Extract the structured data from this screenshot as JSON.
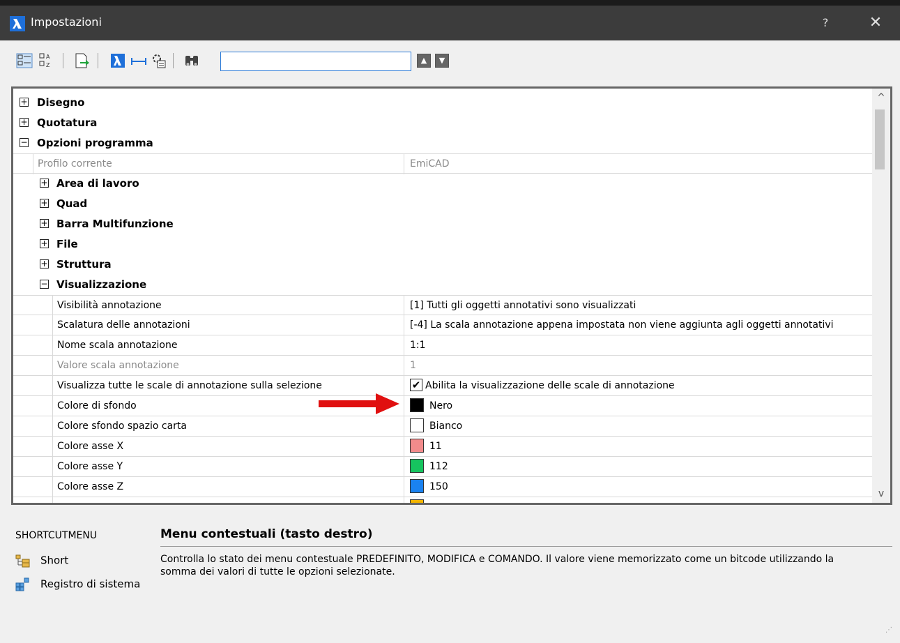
{
  "window": {
    "title": "Impostazioni",
    "help": "?",
    "close": "✕"
  },
  "toolbar": {
    "search_value": "",
    "prev_label": "▲",
    "next_label": "▼"
  },
  "tree": {
    "groups_top": [
      {
        "label": "Disegno",
        "toggle": "+"
      },
      {
        "label": "Quotatura",
        "toggle": "+"
      },
      {
        "label": "Opzioni programma",
        "toggle": "−"
      }
    ],
    "profile": {
      "name": "Profilo corrente",
      "value": "EmiCAD"
    },
    "subgroups": [
      {
        "label": "Area di lavoro",
        "toggle": "+"
      },
      {
        "label": "Quad",
        "toggle": "+"
      },
      {
        "label": "Barra Multifunzione",
        "toggle": "+"
      },
      {
        "label": "File",
        "toggle": "+"
      },
      {
        "label": "Struttura",
        "toggle": "+"
      },
      {
        "label": "Visualizzazione",
        "toggle": "−"
      }
    ],
    "props": [
      {
        "name": "Visibilità annotazione",
        "value": "[1] Tutti gli oggetti annotativi sono visualizzati"
      },
      {
        "name": "Scalatura delle annotazioni",
        "value": "[-4] La scala annotazione appena impostata non viene aggiunta agli oggetti annotativi"
      },
      {
        "name": "Nome scala annotazione",
        "value": "1:1"
      },
      {
        "name": "Valore scala annotazione",
        "value": "1"
      },
      {
        "name": "Visualizza tutte le scale di annotazione sulla selezione",
        "value": "Abilita la visualizzazione delle scale di annotazione",
        "checked": "✔"
      },
      {
        "name": "Colore di sfondo",
        "value": "Nero",
        "color": "#000000"
      },
      {
        "name": "Colore sfondo spazio carta",
        "value": "Bianco",
        "color": "#ffffff"
      },
      {
        "name": "Colore asse X",
        "value": "11",
        "color": "#f28b8b"
      },
      {
        "name": "Colore asse Y",
        "value": "112",
        "color": "#16c45f"
      },
      {
        "name": "Colore asse Z",
        "value": "150",
        "color": "#1a82f0"
      },
      {
        "name": "",
        "value": "",
        "color": "#f2b400"
      }
    ],
    "scroll_up": "^",
    "scroll_down": "v"
  },
  "bottom": {
    "shortcut_title": "SHORTCUTMENU",
    "items": [
      {
        "label": "Short",
        "icon": "folder-tree-icon"
      },
      {
        "label": "Registro di sistema",
        "icon": "registry-icon"
      }
    ],
    "desc_title": "Menu contestuali (tasto destro)",
    "desc_text": "Controlla lo stato dei menu contestuale PREDEFINITO, MODIFICA e COMANDO. Il valore viene memorizzato come un bitcode utilizzando la somma dei valori di tutte le opzioni selezionate."
  },
  "colors": {
    "titlebar": "#3c3c3c",
    "accent": "#2a7ad8",
    "arrow": "#e01010"
  }
}
